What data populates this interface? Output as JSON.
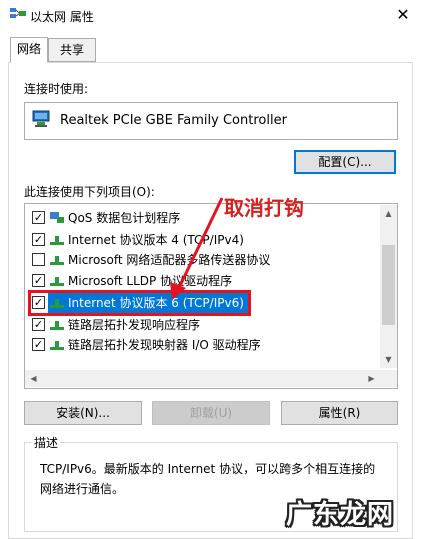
{
  "window": {
    "title": "以太网 属性",
    "close_glyph": "✕"
  },
  "tabs": [
    {
      "label": "网络",
      "active": true
    },
    {
      "label": "共享",
      "active": false
    }
  ],
  "connect_using": {
    "label": "连接时使用:",
    "adapter": "Realtek PCIe GBE Family Controller",
    "configure_button": "配置(C)..."
  },
  "items_section": {
    "label": "此连接使用下列项目(O):",
    "items": [
      {
        "label": "QoS 数据包计划程序",
        "checked": true,
        "icon": "qos-icon"
      },
      {
        "label": "Internet 协议版本 4 (TCP/IPv4)",
        "checked": true,
        "icon": "protocol-icon"
      },
      {
        "label": "Microsoft 网络适配器多路传送器协议",
        "checked": false,
        "icon": "protocol-icon"
      },
      {
        "label": "Microsoft LLDP 协议驱动程序",
        "checked": true,
        "icon": "protocol-icon"
      },
      {
        "label": "Internet 协议版本 6 (TCP/IPv6)",
        "checked": true,
        "icon": "protocol-icon",
        "selected": true
      },
      {
        "label": "链路层拓扑发现响应程序",
        "checked": true,
        "icon": "protocol-icon"
      },
      {
        "label": "链路层拓扑发现映射器 I/O 驱动程序",
        "checked": true,
        "icon": "protocol-icon"
      }
    ]
  },
  "buttons": {
    "install": "安装(N)...",
    "uninstall": "卸载(U)",
    "properties": "属性(R)"
  },
  "description": {
    "legend": "描述",
    "line1": "TCP/IPv6。最新版本的 Internet 协议，可以跨多个相互连接的",
    "line2": "网络进行通信。"
  },
  "annotation": {
    "text": "取消打钩",
    "color": "#d91e1e"
  },
  "watermark": {
    "text": "广东龙网"
  },
  "colors": {
    "accent": "#0078d7",
    "highlight_red": "#e8121e"
  }
}
